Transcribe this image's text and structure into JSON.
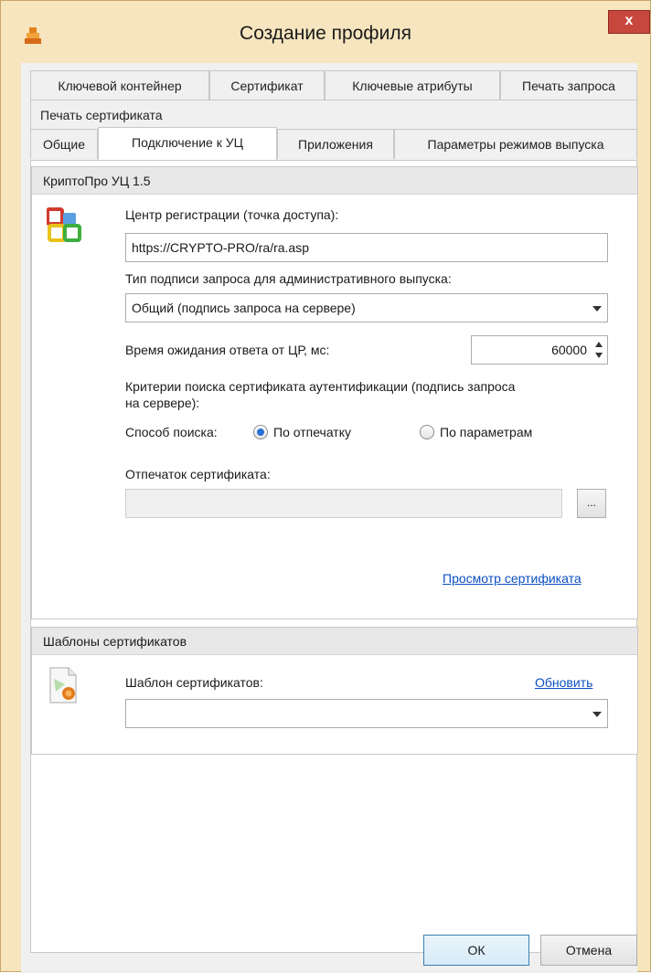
{
  "window": {
    "title": "Создание профиля",
    "close_label": "x"
  },
  "tabs": {
    "row1": [
      "Ключевой контейнер",
      "Сертификат",
      "Ключевые атрибуты",
      "Печать запроса"
    ],
    "row2": [
      "Печать сертификата"
    ],
    "row3": [
      "Общие",
      "Подключение к УЦ",
      "Приложения",
      "Параметры режимов выпуска"
    ],
    "active": "Подключение к УЦ"
  },
  "ca_group": {
    "header": "КриптоПро УЦ 1.5",
    "icon": "ca-blocks-icon",
    "registration_center_label": "Центр регистрации (точка доступа):",
    "registration_center_value": "https://CRYPTO-PRO/ra/ra.asp",
    "signature_type_label": "Тип подписи запроса для административного выпуска:",
    "signature_type_value": "Общий (подпись запроса на сервере)",
    "timeout_label": "Время ожидания ответа от ЦР, мс:",
    "timeout_value": "60000",
    "criteria_label_line1": "Критерии поиска сертификата аутентификации (подпись запроса",
    "criteria_label_line2": "на сервере):",
    "search_method_label": "Способ поиска:",
    "radio_thumbprint": "По отпечатку",
    "radio_params": "По параметрам",
    "radio_selected": "По отпечатку",
    "thumbprint_label": "Отпечаток сертификата:",
    "thumbprint_value": "",
    "browse_label": "...",
    "view_cert_link": "Просмотр сертификата"
  },
  "templates_group": {
    "header": "Шаблоны сертификатов",
    "icon": "certificate-template-icon",
    "template_label": "Шаблон сертификатов:",
    "refresh_link": "Обновить",
    "template_value": ""
  },
  "footer": {
    "ok_label": "ОК",
    "cancel_label": "Отмена"
  },
  "colors": {
    "frame": "#f6e5be",
    "close": "#c7473c",
    "link": "#0b4fc3",
    "radio_selected": "#2a6fd4"
  }
}
